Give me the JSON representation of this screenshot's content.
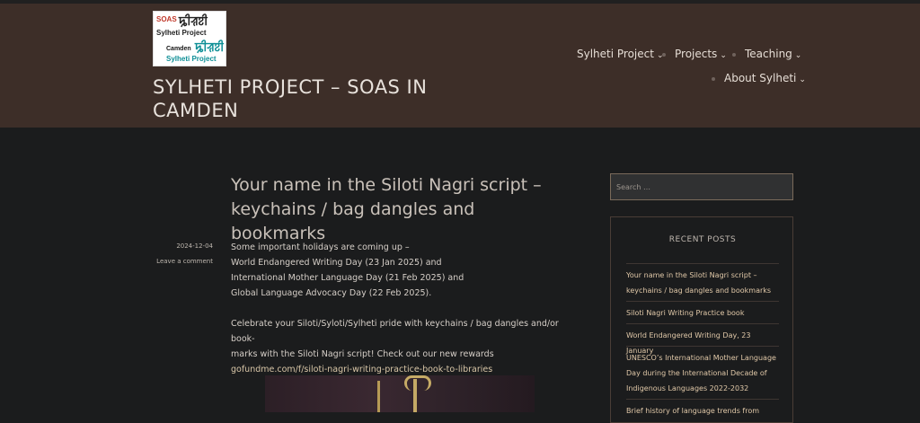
{
  "site": {
    "logo": {
      "line1": "SOAS",
      "line1_script": "ꠍꠤꠟꠐꠤ",
      "line2": "Sylheti Project",
      "line3": "Camden",
      "line3_script": "ꠍꠤꠟꠐꠤ",
      "line4": "Sylheti Project"
    },
    "title": "SYLHETI PROJECT – SOAS IN CAMDEN"
  },
  "nav": {
    "items": [
      {
        "label": "Sylheti Project"
      },
      {
        "label": "Projects"
      },
      {
        "label": "Teaching"
      },
      {
        "label": "About Sylheti"
      }
    ],
    "chevron": "⌄"
  },
  "post": {
    "title": "Your name in the Siloti Nagri script – keychains / bag dangles and bookmarks",
    "date": "2024-12-04",
    "comment_link": "Leave a comment",
    "lines": [
      "Some important holidays are coming up –",
      "World Endangered Writing Day (23 Jan 2025) and",
      "International Mother Language Day (21 Feb 2025) and",
      "Global Language Advocacy Day (22 Feb 2025)."
    ],
    "para2_line1": "Celebrate your Siloti/Syloti/Sylheti pride with keychains / bag dangles and/or book-",
    "para2_line2": "marks with the Siloti Nagri script! Check out our new rewards",
    "link": "gofundme.com/f/siloti-nagri-writing-practice-book-to-libraries"
  },
  "sidebar": {
    "search_placeholder": "Search …",
    "recent_title": "RECENT POSTS",
    "recent": [
      "Your name in the Siloti Nagri script – keychains / bag dangles and bookmarks",
      "Siloti Nagri Writing Practice book",
      "World Endangered Writing Day, 23 January",
      "UNESCO’s International Mother Language Day during the International Decade of Indigenous Languages 2022-2032",
      "Brief history of language trends from"
    ]
  },
  "colors": {
    "header_bg": "#3d2e28",
    "page_bg": "#1b1c1d",
    "link": "#e0c8a8"
  }
}
